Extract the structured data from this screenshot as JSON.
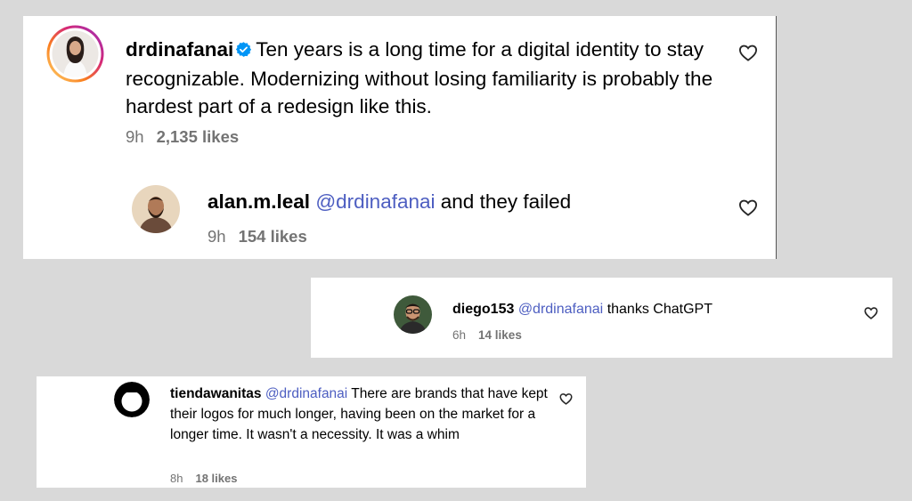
{
  "comments": [
    {
      "username": "drdinafanai",
      "verified": true,
      "text": "Ten years is a long time for a digital identity to stay recognizable. Modernizing without losing familiarity is probably the hardest part of a redesign like this.",
      "time": "9h",
      "likes": "2,135 likes",
      "reply": {
        "username": "alan.m.leal",
        "mention": "@drdinafanai",
        "text": "and they failed",
        "time": "9h",
        "likes": "154 likes"
      }
    },
    {
      "username": "diego153",
      "mention": "@drdinafanai",
      "text": "thanks ChatGPT",
      "time": "6h",
      "likes": "14 likes"
    },
    {
      "username": "tiendawanitas",
      "mention": "@drdinafanai",
      "text": "There are brands that have kept their logos for much longer, having been on the market for a longer time. It wasn't a necessity. It was a whim",
      "time": "8h",
      "likes": "18 likes"
    }
  ],
  "icons": {
    "like": "heart-outline-icon",
    "verified": "verified-badge-icon"
  },
  "colors": {
    "mention": "#4d5ec1",
    "verified": "#0095f6",
    "meta": "#737373",
    "background": "#d9d9d9"
  }
}
